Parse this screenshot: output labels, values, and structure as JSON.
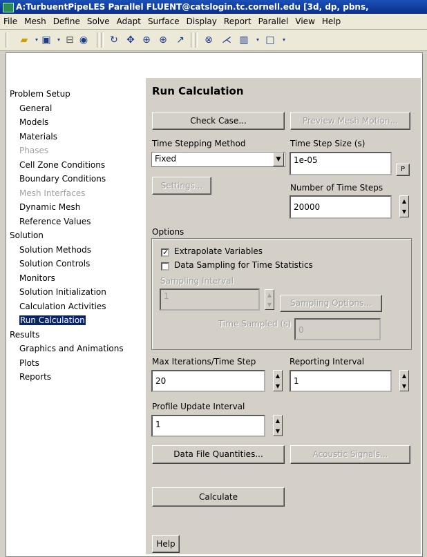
{
  "window": {
    "title": "A:TurbuentPipeLES Parallel FLUENT@catslogin.tc.cornell.edu  [3d, dp, pbns,"
  },
  "menu": [
    "File",
    "Mesh",
    "Define",
    "Solve",
    "Adapt",
    "Surface",
    "Display",
    "Report",
    "Parallel",
    "View",
    "Help"
  ],
  "toolbar_icons": [
    "open-folder-icon",
    "save-icon",
    "print-icon",
    "help-icon",
    "rotate-icon",
    "pan-icon",
    "zoom-in-icon",
    "zoom-region-icon",
    "probe-icon",
    "zoom-to-fit-icon",
    "mesh-icon",
    "layout-icon",
    "window-icon"
  ],
  "tree": {
    "problem_setup": "Problem Setup",
    "ps_items": [
      {
        "label": "General",
        "enabled": true
      },
      {
        "label": "Models",
        "enabled": true
      },
      {
        "label": "Materials",
        "enabled": true
      },
      {
        "label": "Phases",
        "enabled": false
      },
      {
        "label": "Cell Zone Conditions",
        "enabled": true
      },
      {
        "label": "Boundary Conditions",
        "enabled": true
      },
      {
        "label": "Mesh Interfaces",
        "enabled": false
      },
      {
        "label": "Dynamic Mesh",
        "enabled": true
      },
      {
        "label": "Reference Values",
        "enabled": true
      }
    ],
    "solution": "Solution",
    "sol_items": [
      "Solution Methods",
      "Solution Controls",
      "Monitors",
      "Solution Initialization",
      "Calculation Activities",
      "Run Calculation"
    ],
    "selected": "Run Calculation",
    "results": "Results",
    "res_items": [
      "Graphics and Animations",
      "Plots",
      "Reports"
    ]
  },
  "panel": {
    "title": "Run Calculation",
    "check_case": "Check Case...",
    "preview_mesh_motion": "Preview Mesh Motion...",
    "time_stepping_label": "Time Stepping Method",
    "time_stepping_value": "Fixed",
    "time_step_size_label": "Time Step Size (s)",
    "time_step_size_value": "1e-05",
    "p_button": "P",
    "settings": "Settings...",
    "num_steps_label": "Number of Time Steps",
    "num_steps_value": "20000",
    "options_label": "Options",
    "extrapolate": "Extrapolate Variables",
    "extrapolate_checked": true,
    "data_sampling": "Data Sampling for Time Statistics",
    "data_sampling_checked": false,
    "sampling_interval_label": "Sampling Interval",
    "sampling_interval_value": "1",
    "sampling_options": "Sampling Options...",
    "time_sampled_label": "Time Sampled (s)",
    "time_sampled_value": "0",
    "max_iter_label": "Max Iterations/Time Step",
    "max_iter_value": "20",
    "reporting_label": "Reporting Interval",
    "reporting_value": "1",
    "profile_label": "Profile Update Interval",
    "profile_value": "1",
    "data_file_quantities": "Data File Quantities...",
    "acoustic_signals": "Acoustic Signals...",
    "calculate": "Calculate",
    "help": "Help"
  }
}
